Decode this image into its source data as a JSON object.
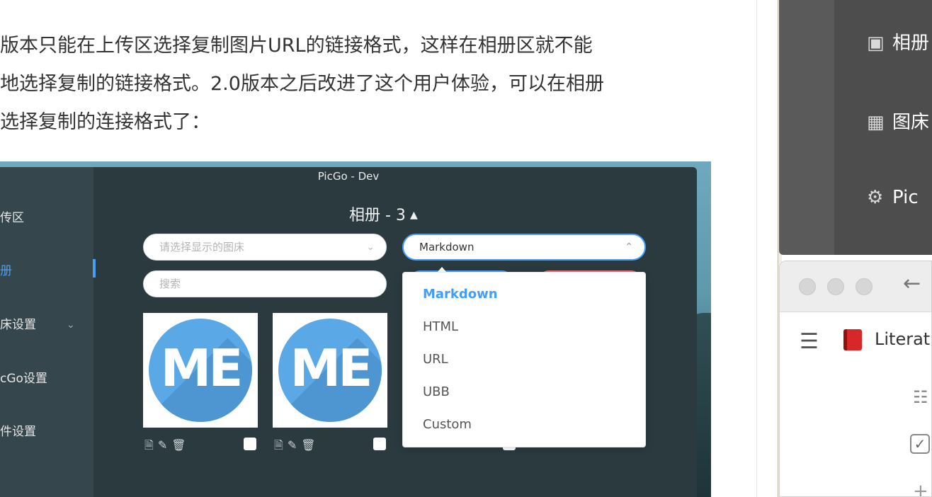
{
  "article": {
    "lines": [
      "版本只能在上传区选择复制图片URL的链接格式，这样在相册区就不能",
      "地选择复制的链接格式。2.0版本之后改进了这个用户体验，可以在相册",
      "选择复制的连接格式了："
    ]
  },
  "screenshot": {
    "window_title": "PicGo - Dev",
    "album_title": "相册 - 3",
    "album_title_icon": "caret-up-icon",
    "sidebar": {
      "items": [
        {
          "label": "传区",
          "active": false
        },
        {
          "label": "册",
          "active": true
        },
        {
          "label": "床设置",
          "active": false
        },
        {
          "label": "cGo设置",
          "active": false
        },
        {
          "label": "件设置",
          "active": false
        }
      ]
    },
    "filters": {
      "picbed_placeholder": "请选择显示的图床",
      "format_value": "Markdown",
      "search_placeholder": "搜索"
    },
    "thumbnails": [
      {
        "logo_text": "ME"
      },
      {
        "logo_text": "ME"
      }
    ],
    "dropdown": {
      "options": [
        "Markdown",
        "HTML",
        "URL",
        "UBB",
        "Custom"
      ],
      "selected": "Markdown"
    },
    "colors": {
      "accent": "#409eff",
      "danger": "#f56c6c",
      "window_bg": "#2b3a3f",
      "sidebar_bg": "#35474c"
    }
  },
  "right_panel": {
    "dark_menu": [
      {
        "icon": "image-icon",
        "label": "相册"
      },
      {
        "icon": "grid-icon",
        "label": "图床"
      },
      {
        "icon": "gear-icon",
        "label": "Pic"
      }
    ],
    "browser": {
      "back_icon": "arrow-left-icon",
      "menu_icon": "hamburger-icon",
      "notebook_title": "Literatu"
    }
  }
}
